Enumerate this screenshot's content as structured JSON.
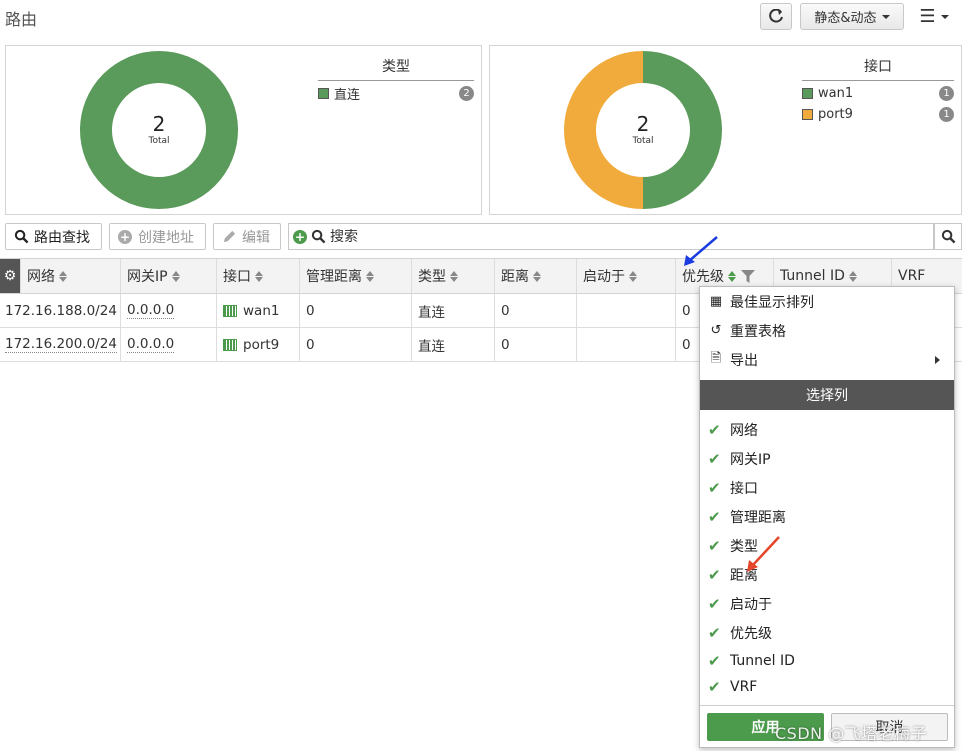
{
  "page": {
    "title": "路由"
  },
  "toolbar_top": {
    "view_label": "静态&动态"
  },
  "charts": {
    "type_chart": {
      "legend_title": "类型",
      "total": "2",
      "total_label": "Total",
      "items": [
        {
          "label": "直连",
          "count": "2",
          "color": "#5a9a5a"
        }
      ]
    },
    "interface_chart": {
      "legend_title": "接口",
      "total": "2",
      "total_label": "Total",
      "items": [
        {
          "label": "wan1",
          "count": "1",
          "color": "#5a9a5a"
        },
        {
          "label": "port9",
          "count": "1",
          "color": "#f0ab3c"
        }
      ]
    }
  },
  "actions": {
    "lookup": "路由查找",
    "create": "创建地址",
    "edit": "编辑",
    "search_placeholder": "搜索"
  },
  "table": {
    "columns": [
      "网络",
      "网关IP",
      "接口",
      "管理距离",
      "类型",
      "距离",
      "启动于",
      "优先级",
      "Tunnel ID",
      "VRF"
    ],
    "rows": [
      {
        "network": "172.16.188.0/24",
        "gateway": "0.0.0.0",
        "interface": "wan1",
        "admin_distance": "0",
        "type": "直连",
        "distance": "0",
        "uptime": "",
        "priority": "0"
      },
      {
        "network": "172.16.200.0/24",
        "gateway": "0.0.0.0",
        "interface": "port9",
        "admin_distance": "0",
        "type": "直连",
        "distance": "0",
        "uptime": "",
        "priority": "0"
      }
    ]
  },
  "dropdown": {
    "best_fit": "最佳显示排列",
    "reset": "重置表格",
    "export": "导出",
    "section_title": "选择列",
    "columns": [
      "网络",
      "网关IP",
      "接口",
      "管理距离",
      "类型",
      "距离",
      "启动于",
      "优先级",
      "Tunnel ID",
      "VRF"
    ],
    "apply": "应用",
    "cancel": "取消"
  },
  "watermark": "CSDN @飞塔老梅子",
  "colors": {
    "accent_green": "#4c9a4c",
    "wan1": "#5a9a5a",
    "port9": "#f0ab3c",
    "arrow_blue": "#1a3be0",
    "arrow_red": "#e5452a"
  }
}
